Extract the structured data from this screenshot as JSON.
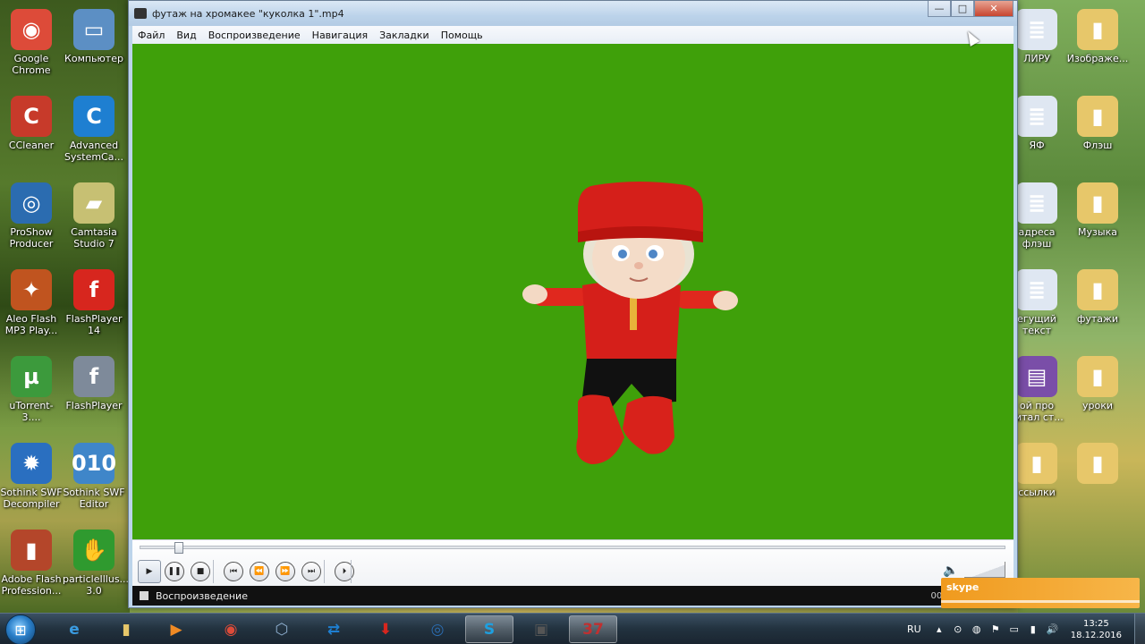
{
  "desktop_left_icons": [
    {
      "label": "Google Chrome",
      "icon": "chrome-icon",
      "color": "#dd4b39",
      "glyph": "◉"
    },
    {
      "label": "Компьютер",
      "icon": "computer-icon",
      "color": "#5c8fc4",
      "glyph": "▭"
    },
    {
      "label": "CCleaner",
      "icon": "ccleaner-icon",
      "color": "#c73a2a",
      "glyph": "C"
    },
    {
      "label": "Advanced SystemCa...",
      "icon": "advanced-systemcare-icon",
      "color": "#1e7fd1",
      "glyph": "C"
    },
    {
      "label": "ProShow Producer",
      "icon": "proshow-icon",
      "color": "#2b6cb0",
      "glyph": "◎"
    },
    {
      "label": "Camtasia Studio 7",
      "icon": "camtasia-icon",
      "color": "#c7c073",
      "glyph": "▰"
    },
    {
      "label": "Aleo Flash MP3 Play...",
      "icon": "aleo-flash-icon",
      "color": "#c0541f",
      "glyph": "✦"
    },
    {
      "label": "FlashPlayer 14",
      "icon": "flashplayer-icon",
      "color": "#d7261e",
      "glyph": "f"
    },
    {
      "label": "uTorrent-3....",
      "icon": "utorrent-icon",
      "color": "#3c9a3c",
      "glyph": "µ"
    },
    {
      "label": "FlashPlayer",
      "icon": "flashplayer-icon",
      "color": "#7e8a9a",
      "glyph": "f"
    },
    {
      "label": "Sothink SWF Decompiler",
      "icon": "sothink-decompiler-icon",
      "color": "#2a6fc0",
      "glyph": "✹"
    },
    {
      "label": "Sothink SWF Editor",
      "icon": "sothink-editor-icon",
      "color": "#3f86c9",
      "glyph": "010"
    },
    {
      "label": "Adobe Flash Profession...",
      "icon": "adobe-flash-icon",
      "color": "#b4462a",
      "glyph": "▮"
    },
    {
      "label": "particleIllus... 3.0",
      "icon": "particle-illusion-icon",
      "color": "#2f9a2f",
      "glyph": "✋"
    }
  ],
  "desktop_right_icons": [
    {
      "label": "ЛИРУ",
      "icon": "document-icon",
      "color": "#dfe7f2",
      "glyph": "≣"
    },
    {
      "label": "Изображе...",
      "icon": "folder-icon",
      "color": "#e7c76a",
      "glyph": "▮"
    },
    {
      "label": "ЯФ",
      "icon": "document-icon",
      "color": "#dfe7f2",
      "glyph": "≣"
    },
    {
      "label": "Флэш",
      "icon": "folder-icon",
      "color": "#e7c76a",
      "glyph": "▮"
    },
    {
      "label": "адреса флэш",
      "icon": "document-icon",
      "color": "#dfe7f2",
      "glyph": "≣"
    },
    {
      "label": "Музыка",
      "icon": "folder-icon",
      "color": "#e7c76a",
      "glyph": "▮"
    },
    {
      "label": "егущий текст",
      "icon": "document-icon",
      "color": "#dfe7f2",
      "glyph": "≣"
    },
    {
      "label": "футажи",
      "icon": "folder-icon",
      "color": "#e7c76a",
      "glyph": "▮"
    },
    {
      "label": "ой про гитал ст...",
      "icon": "archive-icon",
      "color": "#7a4ea8",
      "glyph": "▤"
    },
    {
      "label": "уроки",
      "icon": "folder-icon",
      "color": "#e7c76a",
      "glyph": "▮"
    },
    {
      "label": "ссылки",
      "icon": "folder-icon",
      "color": "#e7c76a",
      "glyph": "▮"
    },
    {
      "label": "",
      "icon": "folder-icon",
      "color": "#e7c76a",
      "glyph": "▮"
    }
  ],
  "window": {
    "title": "футаж на хромакее \"куколка 1\".mp4",
    "minimize": "—",
    "maximize": "□",
    "close": "✕",
    "menu": [
      "Файл",
      "Вид",
      "Воспроизведение",
      "Навигация",
      "Закладки",
      "Помощь"
    ],
    "video_bg": "#3fa00a",
    "status_text": "Воспроизведение",
    "status_time": "00:0",
    "seek_fraction": 0.04
  },
  "controls": [
    {
      "name": "play-button",
      "glyph": "▶"
    },
    {
      "name": "pause-button",
      "glyph": "❚❚"
    },
    {
      "name": "stop-button",
      "glyph": "■"
    },
    {
      "name": "previous-button",
      "glyph": "⏮"
    },
    {
      "name": "rewind-button",
      "glyph": "⏪"
    },
    {
      "name": "fast-forward-button",
      "glyph": "⏩"
    },
    {
      "name": "next-button",
      "glyph": "⏭"
    },
    {
      "name": "frame-step-button",
      "glyph": "⏵"
    }
  ],
  "skype_badge": "skype",
  "taskbar": {
    "items": [
      {
        "name": "taskbar-ie",
        "icon": "ie-icon",
        "glyph": "e",
        "color": "#3a9be0"
      },
      {
        "name": "taskbar-explorer",
        "icon": "folder-icon",
        "glyph": "▮",
        "color": "#e7c76a"
      },
      {
        "name": "taskbar-media-player",
        "icon": "media-player-icon",
        "glyph": "▶",
        "color": "#f08a24"
      },
      {
        "name": "taskbar-chrome",
        "icon": "chrome-icon",
        "glyph": "◉",
        "color": "#dd4b39"
      },
      {
        "name": "taskbar-network",
        "icon": "network-icon",
        "glyph": "⬡",
        "color": "#8fb0d0"
      },
      {
        "name": "taskbar-teamviewer",
        "icon": "teamviewer-icon",
        "glyph": "⇄",
        "color": "#1e7fd1"
      },
      {
        "name": "taskbar-downloader",
        "icon": "download-icon",
        "glyph": "⬇",
        "color": "#d7261e"
      },
      {
        "name": "taskbar-proshow",
        "icon": "proshow-icon",
        "glyph": "◎",
        "color": "#2b6cb0"
      },
      {
        "name": "taskbar-skype",
        "icon": "skype-icon",
        "glyph": "S",
        "color": "#1ea0e0",
        "active": true
      },
      {
        "name": "taskbar-camcorder",
        "icon": "camcorder-icon",
        "glyph": "▣",
        "color": "#555"
      },
      {
        "name": "taskbar-player",
        "icon": "video-player-icon",
        "glyph": "37",
        "color": "#c03030",
        "active": true
      }
    ],
    "language": "RU",
    "time": "13:25",
    "date": "18.12.2016"
  }
}
